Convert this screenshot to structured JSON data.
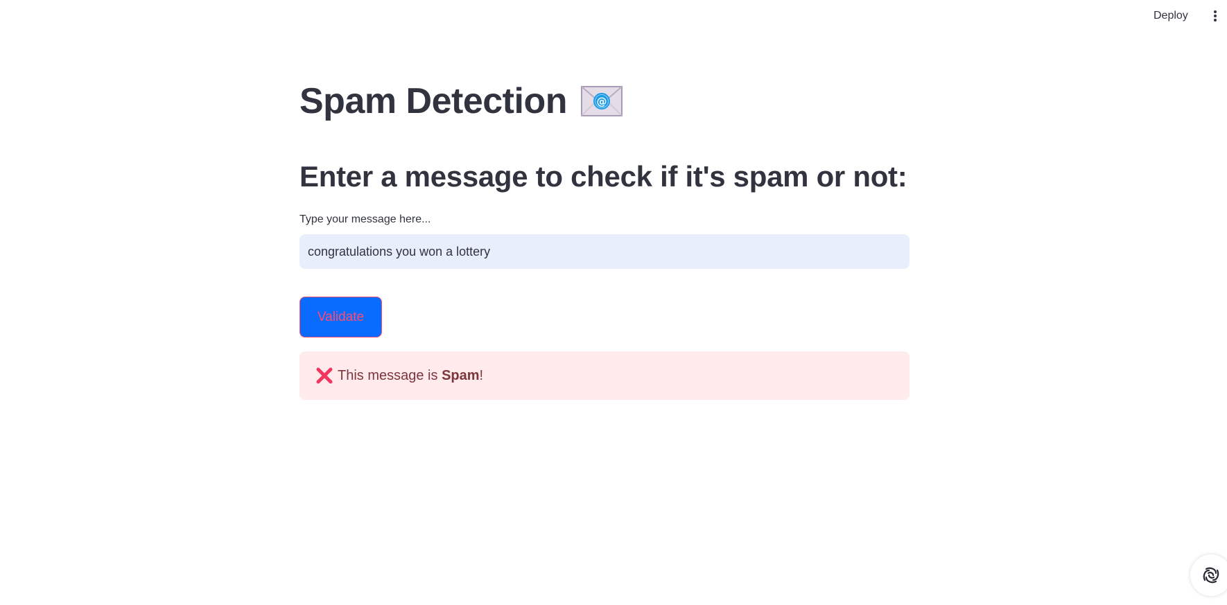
{
  "header": {
    "deploy_label": "Deploy",
    "menu_icon": "more-vertical-icon"
  },
  "main": {
    "title": "Spam Detection",
    "title_icon": "envelope-with-at-icon",
    "subheading": "Enter a message to check if it's spam or not:",
    "input": {
      "label": "Type your message here...",
      "value": "congratulations you won a lottery"
    },
    "validate_label": "Validate",
    "result": {
      "icon": "cross-mark-icon",
      "prefix": "This message is ",
      "verdict": "Spam",
      "suffix": "!"
    }
  },
  "colors": {
    "text": "#31333f",
    "input_bg": "#e8eefb",
    "button_bg": "#0a6cff",
    "button_text": "#ff4b6e",
    "alert_bg": "#ffebec",
    "alert_text": "#7d353b",
    "cross": "#f4365e"
  },
  "widget": {
    "icon": "streamlit-status-icon"
  }
}
